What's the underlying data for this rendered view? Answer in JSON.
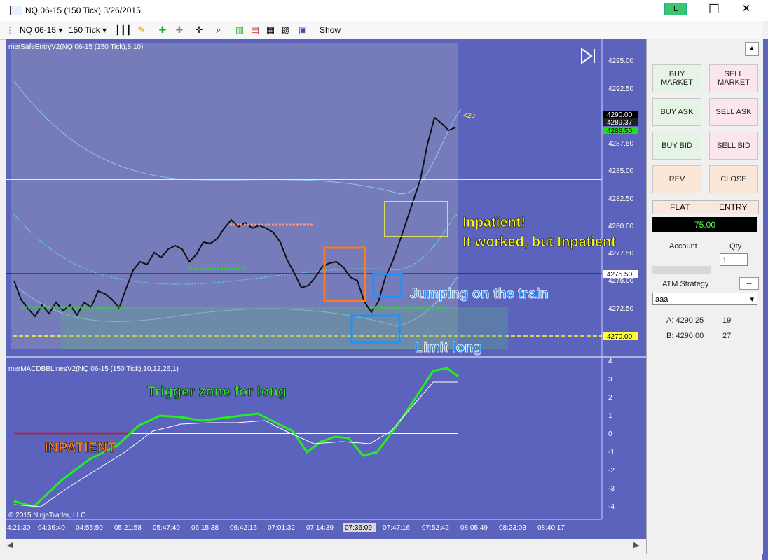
{
  "window": {
    "title": "NQ 06-15 (150 Tick)  3/26/2015",
    "badge": "L",
    "minimize": "—",
    "maximize": "☐",
    "close": "✕"
  },
  "toolbar": {
    "instrument": "NQ 06-15",
    "period": "150 Tick",
    "show_label": "Show"
  },
  "price_chart": {
    "indicator_label": "merSafeEntryV2(NQ 06-15 (150 Tick),8,10)",
    "price_axis": [
      "4295.00",
      "4292.50",
      "4290.00",
      "4287.50",
      "4285.00",
      "4282.50",
      "4280.00",
      "4277.50",
      "4275.00",
      "4272.50",
      "4270.00"
    ],
    "markers": {
      "last": "4290.00",
      "bid": "4289.37",
      "green": "4288.50",
      "current": "4275.50",
      "limit": "4270.00",
      "tick_note": "<20"
    }
  },
  "macd_chart": {
    "indicator_label": "merMACDBBLinesV2(NQ 06-15 (150 Tick),10,12,26,1)",
    "axis": [
      "4",
      "3",
      "2",
      "1",
      "0",
      "-1",
      "-2",
      "-3",
      "-4"
    ]
  },
  "time_axis": [
    "4:21:30",
    "04:36:40",
    "04:55:50",
    "05:21:58",
    "05:47:40",
    "06:15:38",
    "06:42:16",
    "07:01:32",
    "07:14:39",
    "07:36:09",
    "07:47:16",
    "07:52:42",
    "08:05:49",
    "08:23:03",
    "08:40:17"
  ],
  "annotations": {
    "inpatient_title": "Inpatient!",
    "inpatient_sub": "It worked, but Inpatient",
    "jumping": "Jumping on the train",
    "limit_long": "Limit long",
    "trigger_zone": "Trigger zone for long",
    "inpatient_caps": "INPATIENT",
    "copyright": "© 2015 NinjaTrader, LLC"
  },
  "order_panel": {
    "buy_market": "BUY MARKET",
    "sell_market": "SELL MARKET",
    "buy_ask": "BUY ASK",
    "sell_ask": "SELL ASK",
    "buy_bid": "BUY BID",
    "sell_bid": "SELL BID",
    "rev": "REV",
    "close": "CLOSE",
    "flat": "FLAT",
    "entry": "ENTRY",
    "pnl": "75.00",
    "account_label": "Account",
    "qty_label": "Qty",
    "qty_value": "1",
    "atm_label": "ATM Strategy",
    "atm_button": "...",
    "atm_value": "aaa",
    "fills": [
      {
        "side": "A: 4290.25",
        "qty": "19"
      },
      {
        "side": "B: 4290.00",
        "qty": "27"
      }
    ]
  },
  "colors": {
    "chart_bg": "#5b63bc",
    "annotation_yellow": "#ffff00",
    "annotation_blue": "#1e90ff",
    "annotation_green": "#33dd33",
    "annotation_orange": "#ff7a1a"
  }
}
